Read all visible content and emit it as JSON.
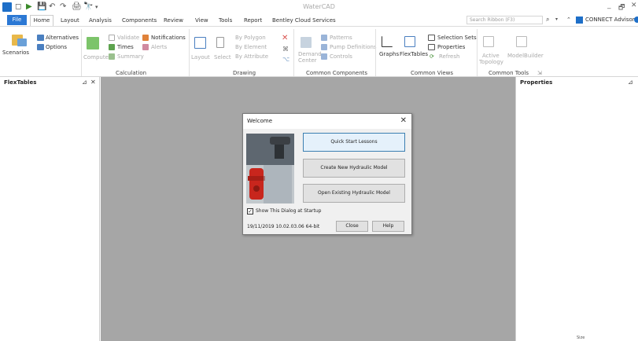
{
  "window": {
    "title": "WaterCAD",
    "minimize": "_",
    "restore": "🗗",
    "close": "✕"
  },
  "quick_access": [
    "◻",
    "▶",
    "💾",
    "↶",
    "↷",
    "🖨",
    "🔭",
    "▾"
  ],
  "tabs": [
    "File",
    "Home",
    "Layout",
    "Analysis",
    "Components",
    "Review",
    "View",
    "Tools",
    "Report",
    "Bentley Cloud Services"
  ],
  "search": {
    "placeholder": "Search Ribbon (F3)"
  },
  "connect": {
    "label": "CONNECT Advisor"
  },
  "ribbon": {
    "scenarios": "Scenarios",
    "alternatives": "Alternatives",
    "options": "Options",
    "compute": "Compute",
    "validate": "Validate",
    "times": "Times",
    "summary": "Summary",
    "notifications": "Notifications",
    "alerts": "Alerts",
    "layout": "Layout",
    "select": "Select",
    "by_polygon": "By Polygon",
    "by_element": "By Element",
    "by_attribute": "By Attribute",
    "demand_center": [
      "Demand",
      "Center"
    ],
    "patterns": "Patterns",
    "pump_definitions": "Pump Definitions",
    "controls": "Controls",
    "graphs": "Graphs",
    "flextables": "FlexTables",
    "selection_sets": "Selection Sets",
    "properties": "Properties",
    "refresh": "Refresh",
    "active_topology": [
      "Active",
      "Topology"
    ],
    "modelbuilder": "ModelBuilder",
    "groups": {
      "calculation": "Calculation",
      "drawing": "Drawing",
      "common_components": "Common Components",
      "common_views": "Common Views",
      "common_tools": "Common Tools"
    }
  },
  "panes": {
    "left_title": "FlexTables",
    "right_title": "Properties",
    "pin": "⊿",
    "close": "✕"
  },
  "dialog": {
    "title": "Welcome",
    "close": "✕",
    "buttons": {
      "quick_start": "Quick Start Lessons",
      "create_new": "Create New Hydraulic Model",
      "open_existing": "Open Existing Hydraulic Model"
    },
    "checkbox_label": "Show This Dialog at Startup",
    "checkbox_checked": true,
    "version": "19/11/2019  10.02.03.06  64-bit",
    "close_btn": "Close",
    "help_btn": "Help"
  },
  "status": {
    "text": "Size"
  }
}
